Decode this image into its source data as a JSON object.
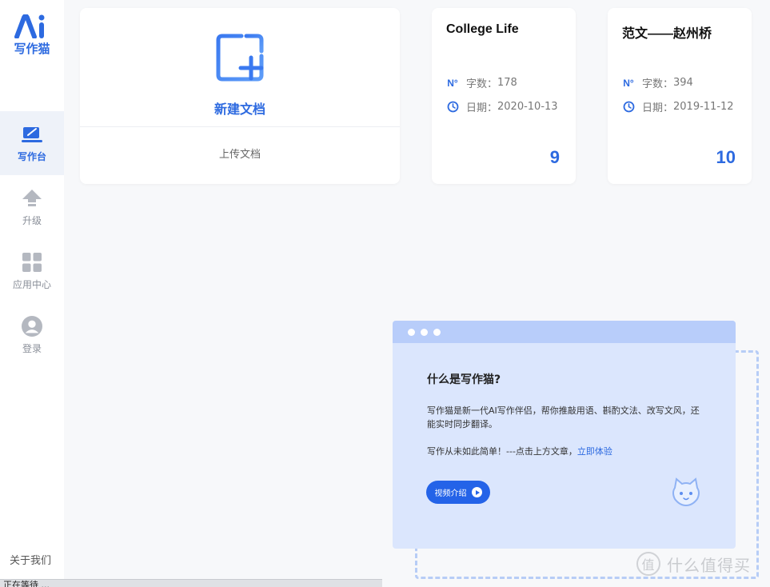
{
  "sidebar": {
    "logo_text": "写作猫",
    "items": [
      {
        "label": "写作台",
        "icon": "desk-icon",
        "active": true
      },
      {
        "label": "升级",
        "icon": "upgrade-arrow-icon",
        "active": false
      },
      {
        "label": "应用中心",
        "icon": "apps-grid-icon",
        "active": false
      },
      {
        "label": "登录",
        "icon": "user-avatar-icon",
        "active": false
      }
    ],
    "about": "关于我们"
  },
  "new_doc": {
    "label": "新建文档",
    "upload": "上传文档"
  },
  "documents": [
    {
      "title": "College Life",
      "words_label": "字数：",
      "words": "178",
      "date_label": "日期：",
      "date": "2020-10-13",
      "count": "9"
    },
    {
      "title": "范文——赵州桥",
      "words_label": "字数：",
      "words": "394",
      "date_label": "日期：",
      "date": "2019-11-12",
      "count": "10"
    }
  ],
  "intro": {
    "title": "什么是写作猫?",
    "desc": "写作猫是新一代AI写作伴侣，帮你推敲用语、斟酌文法、改写文风，还能实时同步翻译。",
    "cta_text": "写作从未如此简单！---点击上方文章，",
    "cta_link": "立即体验",
    "video_button": "视频介绍"
  },
  "status_text": "正在等待 ...",
  "watermark": "什么值得买",
  "colors": {
    "accent": "#2d6ae0",
    "sidebar_bg": "#ffffff",
    "page_bg": "#f7f8fa",
    "intro_bg": "#dbe6fd",
    "intro_head": "#b8cdfa"
  }
}
